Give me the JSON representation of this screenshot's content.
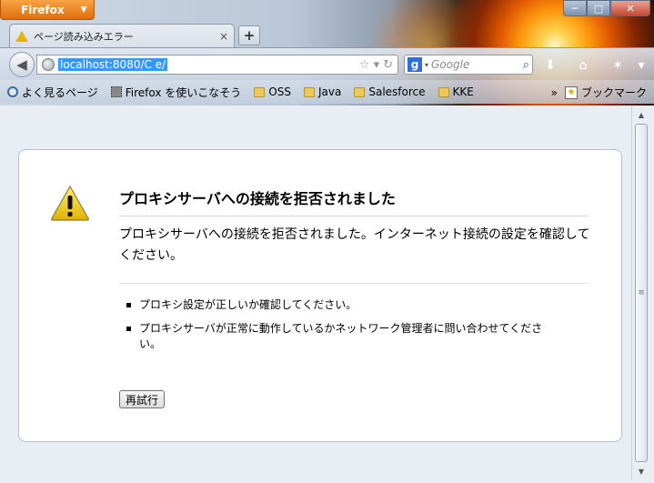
{
  "app": {
    "menu_button": "Firefox"
  },
  "window_controls": {
    "minimize": "─",
    "maximize": "□",
    "close": "✕"
  },
  "tab": {
    "title": "ページ読み込みエラー",
    "close": "×",
    "new_tab": "+"
  },
  "navbar": {
    "url": "localhost:8080/C                  e/",
    "search_engine": "g",
    "search_placeholder": "Google",
    "search_button": "⌕"
  },
  "bookmarks": {
    "items": [
      {
        "label": "よく見るページ",
        "icon": "magnifier-icon"
      },
      {
        "label": "Firefox を使いこなそう",
        "icon": "dotted-square-icon"
      },
      {
        "label": "OSS",
        "icon": "folder-icon"
      },
      {
        "label": "Java",
        "icon": "folder-icon"
      },
      {
        "label": "Salesforce",
        "icon": "folder-icon"
      },
      {
        "label": "KKE",
        "icon": "folder-icon"
      }
    ],
    "overflow": "»",
    "bookmarks_menu": "ブックマーク"
  },
  "error": {
    "title": "プロキシサーバへの接続を拒否されました",
    "description": "プロキシサーバへの接続を拒否されました。インターネット接続の設定を確認してください。",
    "items": [
      "プロキシ設定が正しいか確認してください。",
      "プロキシサーバが正常に動作しているかネットワーク管理者に問い合わせてください。"
    ],
    "retry_button": "再試行"
  },
  "colors": {
    "accent": "#e36d0c",
    "selection": "#3399ff",
    "warning": "#e3b400"
  }
}
